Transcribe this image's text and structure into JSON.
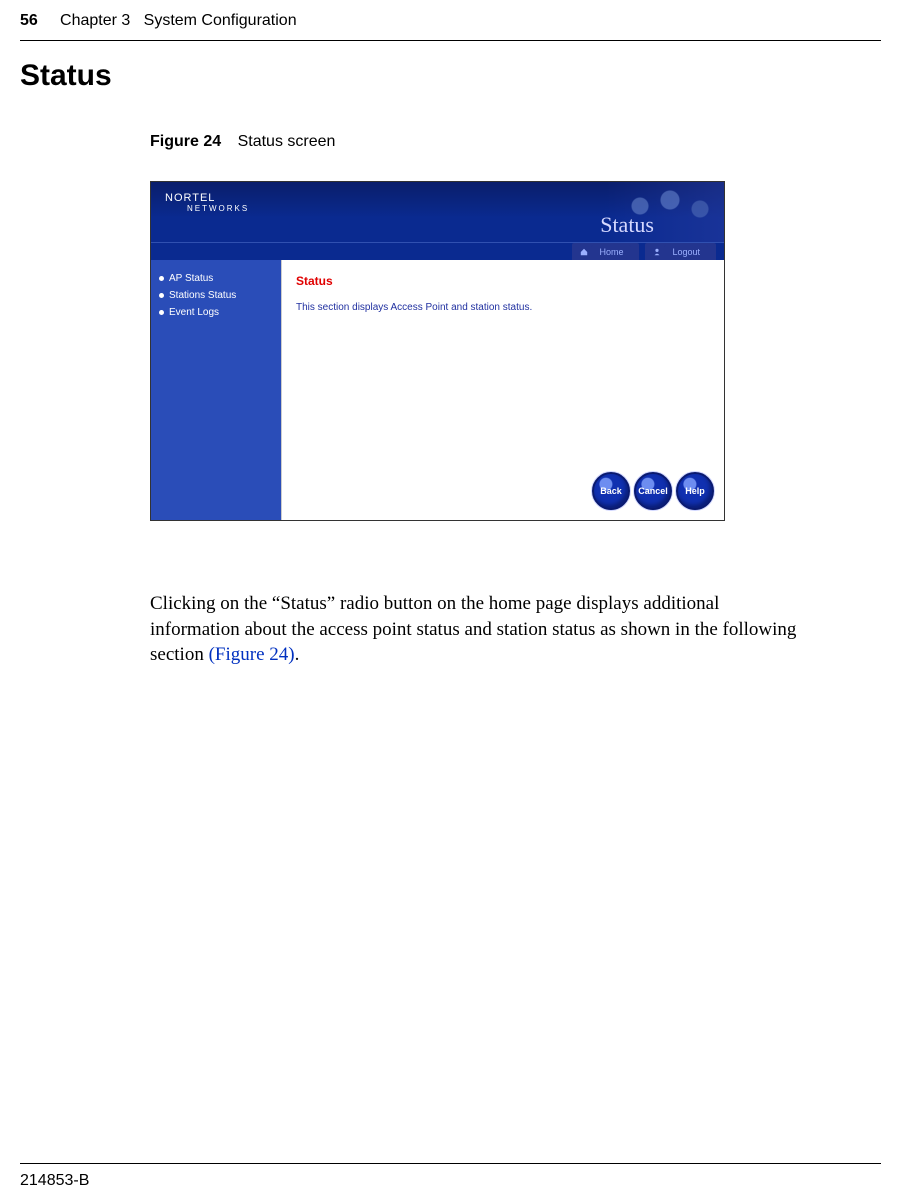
{
  "header": {
    "page_number": "56",
    "chapter": "Chapter 3",
    "chapter_title": "System Configuration"
  },
  "section": {
    "title": "Status"
  },
  "figure": {
    "label": "Figure 24",
    "caption": "Status screen"
  },
  "screenshot": {
    "logo": {
      "brand": "NORTEL",
      "sub": "NETWORKS"
    },
    "banner_title": "Status",
    "topbar": {
      "home": "Home",
      "logout": "Logout"
    },
    "sidebar": {
      "items": [
        {
          "label": "AP Status"
        },
        {
          "label": "Stations Status"
        },
        {
          "label": "Event Logs"
        }
      ]
    },
    "main": {
      "title": "Status",
      "text": "This section displays Access Point and station status."
    },
    "buttons": {
      "back": "Back",
      "cancel": "Cancel",
      "help": "Help"
    }
  },
  "paragraph": {
    "pre": "Clicking on the “Status” radio button on the home page displays additional information about the access point status and station status as shown in the following section ",
    "ref": "(Figure 24)",
    "post": "."
  },
  "footer": {
    "doc_id": "214853-B"
  }
}
